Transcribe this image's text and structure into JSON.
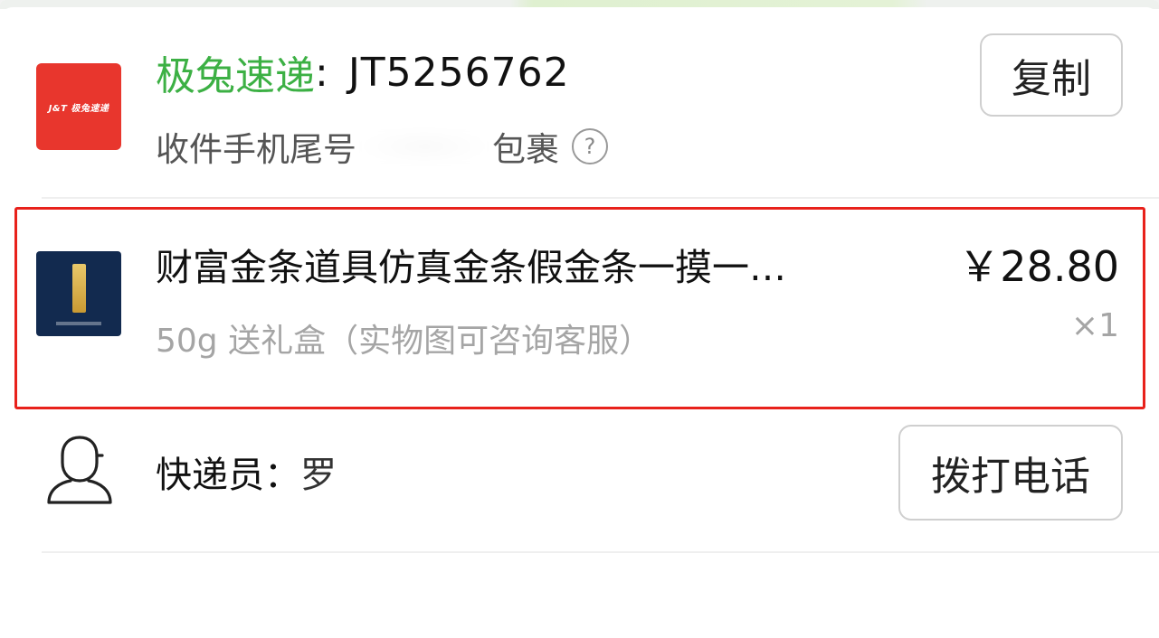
{
  "shipment": {
    "carrier": "极兔速递",
    "separator": ":",
    "tracking_number": "JT5256762",
    "logo_text": "J&T 极兔速递",
    "receiver_prefix": "收件手机尾号",
    "receiver_suffix": "包裹",
    "help_icon": "?",
    "copy_label": "复制"
  },
  "product": {
    "title": "财富金条道具仿真金条假金条一摸一…",
    "spec": "50g 送礼盒（实物图可咨询客服）",
    "price": "￥28.80",
    "quantity": "×1"
  },
  "courier": {
    "label": "快递员：",
    "name_visible": "罗",
    "call_label": "拨打电话"
  },
  "colors": {
    "carrier_green": "#3cb044",
    "logo_red": "#e8362d",
    "highlight_red": "#e8211b",
    "thumb_navy": "#122a4f"
  }
}
